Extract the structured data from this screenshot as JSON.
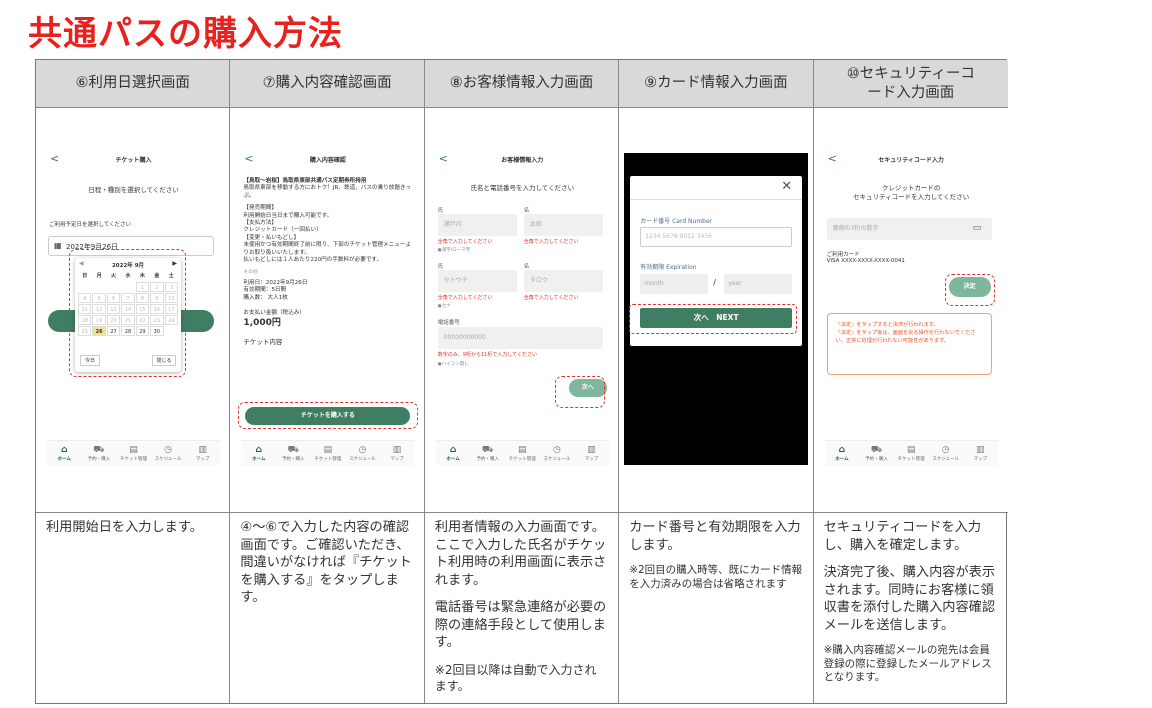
{
  "title": "共通パスの購入方法",
  "columns": [
    {
      "header": "⑥利用日選択画面",
      "desc": [
        "利用開始日を入力します。"
      ],
      "desc_small": []
    },
    {
      "header": "⑦購入内容確認画面",
      "desc": [
        "④～⑥で入力した内容の確認画面です。ご確認いただき、間違いがなければ『チケットを購入する』をタップします。"
      ],
      "desc_small": []
    },
    {
      "header": "⑧お客様情報入力画面",
      "desc": [
        "利用者情報の入力画面です。ここで入力した氏名がチケット利用時の利用画面に表示されます。",
        "電話番号は緊急連絡が必要の際の連絡手段として使用します。"
      ],
      "desc_small": [
        "※2回目以降は自動で入力されます。"
      ]
    },
    {
      "header": "⑨カード情報入力画面",
      "desc": [
        "カード番号と有効期限を入力します。"
      ],
      "desc_small": [
        "※2回目の購入時等、既にカード情報を入力済みの場合は省略されます"
      ]
    },
    {
      "header": "⑩セキュリティーコード入力画面",
      "desc": [
        "セキュリティコードを入力し、購入を確定します。",
        "決済完了後、購入内容が表示されます。同時にお客様に領収書を添付した購入内容確認メールを送信します。"
      ],
      "desc_small": [
        "※購入内容確認メールの宛先は会員登録の際に登録したメールアドレスとなります。"
      ]
    }
  ],
  "nav": [
    "ホーム",
    "予約・購入",
    "チケット管理",
    "スケジュール",
    "マップ"
  ],
  "s6": {
    "title": "チケット購入",
    "subtitle": "日程・種別を選択してください",
    "label": "ご利用予定日を選択してください",
    "date": "2022年9月26日",
    "month": "2022年 9月",
    "weekdays": [
      "日",
      "月",
      "火",
      "水",
      "木",
      "金",
      "土"
    ],
    "days": [
      "",
      "",
      "",
      "",
      "1",
      "2",
      "3",
      "4",
      "5",
      "6",
      "7",
      "8",
      "9",
      "10",
      "11",
      "12",
      "13",
      "14",
      "15",
      "16",
      "17",
      "18",
      "19",
      "20",
      "21",
      "22",
      "23",
      "24",
      "25",
      "26",
      "27",
      "28",
      "29",
      "30",
      ""
    ],
    "today": "今日",
    "close": "閉じる"
  },
  "s7": {
    "title": "購入内容確認",
    "heading": "【鳥取～岩桜】鳥取県東部共通パス定期券所持用",
    "lines": [
      "鳥取県東部を移動する方におトク！JR、鉄道、バスの乗り放題きっぷ。",
      "【発売期間】",
      "利用開始日当日まで購入可能です。",
      "【支払方法】",
      "クレジットカード（一回払い）",
      "【変更・払いもどし】",
      "未使用かつ有効期間終了前に限り、下部のチケット管理メニューよりお取り扱いいたします。",
      "払いもどしには１人あたり220円の手数料が必要です。"
    ],
    "other": "その他",
    "info": [
      "利用日：2022年9月26日",
      "有効期間：5日間",
      "購入数： 大人1枚"
    ],
    "price_label": "お支払い金額（税込み）",
    "price": "1,000円",
    "ticket_label": "チケット内容",
    "button": "チケットを購入する"
  },
  "s8": {
    "title": "お客様情報入力",
    "subtitle": "氏名と電話番号を入力してください",
    "sei": "氏",
    "mei": "名",
    "sei_ph": "瀬戸内",
    "mei_ph": "太郎",
    "sei_kana_ph": "セトウチ",
    "mei_kana_ph": "タロウ",
    "err": "全角で入力してください",
    "note1": "●漢字/ローマ字",
    "note2": "●カナ",
    "phone_label": "電話番号",
    "phone_ph": "00000000000",
    "phone_err": "数字のみ、9桁から11桁で入力してください",
    "phone_note": "●ハイフン無し",
    "next": "次へ"
  },
  "s9": {
    "close": "✕",
    "card_label": "カード番号 Card Number",
    "card_ph": "1234 5678 9012 3456",
    "exp_label": "有効期限 Expiration",
    "month_ph": "month",
    "year_ph": "year",
    "slash": "/",
    "next": "次へ　NEXT"
  },
  "s10": {
    "title": "セキュリティコード入力",
    "subtitle": "クレジットカードの\nセキュリティコードを入力してください",
    "input_ph": "裏側の3桁の数字",
    "card_label": "ご利用カード",
    "card_no": "VISA XXXX-XXXX-XXXX-0041",
    "confirm": "決定",
    "warn": "『決定』をタップすると決済が行われます。\n『決定』をタップ後は、画面を戻る操作を行わないでください。正常に処理が行われない可能性があります。"
  }
}
